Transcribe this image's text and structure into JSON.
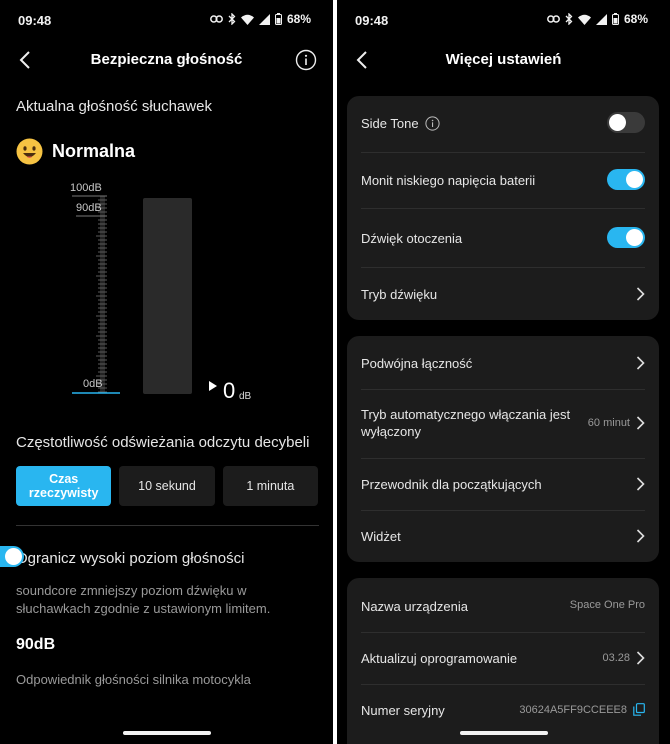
{
  "status": {
    "time": "09:48",
    "battery": "68%"
  },
  "left": {
    "title": "Bezpieczna głośność",
    "current_label": "Aktualna głośność słuchawek",
    "level_text": "Normalna",
    "meter": {
      "top_label": "100dB",
      "limit_label": "90dB",
      "zero_label": "0dB",
      "value": "0",
      "unit": "dB"
    },
    "refresh_label": "Częstotliwość odświeżania odczytu decybeli",
    "refresh_options": [
      "Czas rzeczywisty",
      "10 sekund",
      "1 minuta"
    ],
    "refresh_selected": "Czas rzeczywisty",
    "limit_label": "Ogranicz wysoki poziom głośności",
    "limit_enabled": true,
    "limit_desc": "soundcore zmniejszy poziom dźwięku w słuchawkach zgodnie z ustawionym limitem.",
    "limit_value": "90dB",
    "limit_equiv": "Odpowiednik głośności silnika motocykla"
  },
  "right": {
    "title": "Więcej ustawień",
    "card1": [
      {
        "label": "Side Tone",
        "type": "toggle",
        "on": false
      },
      {
        "label": "Monit niskiego napięcia baterii",
        "type": "toggle",
        "on": true
      },
      {
        "label": "Dźwięk otoczenia",
        "type": "toggle",
        "on": true
      },
      {
        "label": "Tryb dźwięku",
        "type": "nav"
      }
    ],
    "card2": [
      {
        "label": "Podwójna łączność",
        "value": ""
      },
      {
        "label": "Tryb automatycznego włączania jest wyłączony",
        "value": "60 minut"
      },
      {
        "label": "Przewodnik dla początkujących",
        "value": ""
      },
      {
        "label": "Widżet",
        "value": ""
      }
    ],
    "card3": [
      {
        "label": "Nazwa urządzenia",
        "value": "Space One Pro"
      },
      {
        "label": "Aktualizuj oprogramowanie",
        "value": "03.28"
      },
      {
        "label": "Numer seryjny",
        "value": "30624A5FF9CCEEE8"
      }
    ]
  },
  "colors": {
    "accent": "#29b6f0",
    "card": "#1c1c1c",
    "background": "#000000"
  }
}
